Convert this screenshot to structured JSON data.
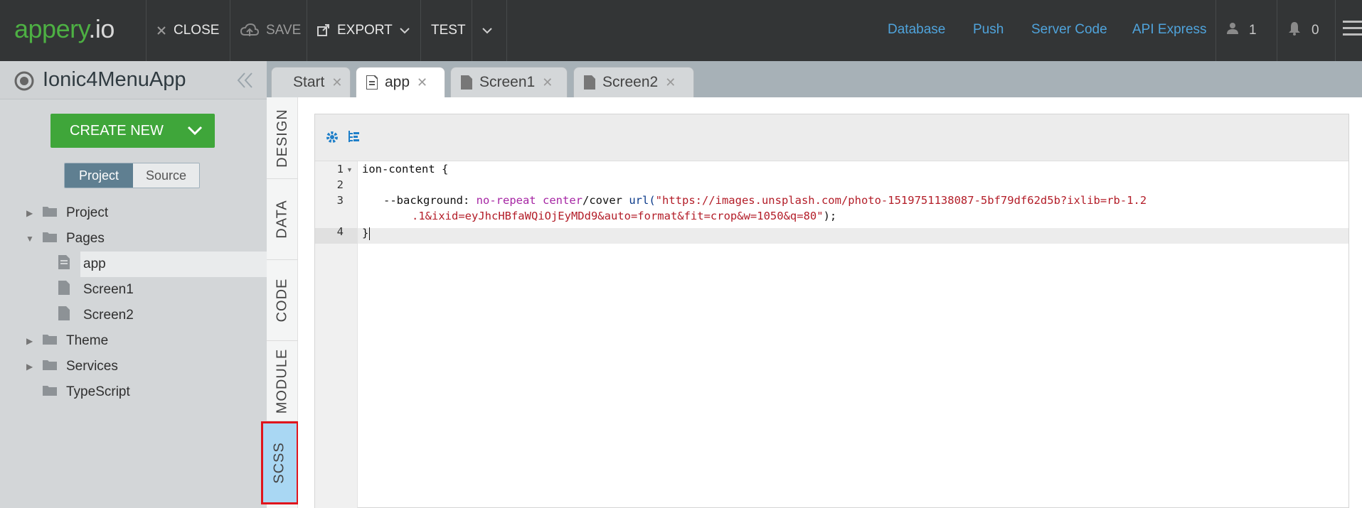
{
  "app": {
    "logo_main": "appery",
    "logo_suffix": ".io"
  },
  "toolbar": {
    "close_label": "CLOSE",
    "save_label": "SAVE",
    "export_label": "EXPORT",
    "test_label": "TEST",
    "links": [
      "Database",
      "Push",
      "Server Code",
      "API Express"
    ],
    "users_count": "1",
    "notifications_count": "0"
  },
  "project": {
    "title": "Ionic4MenuApp",
    "create_new_label": "CREATE NEW",
    "view_toggle": {
      "selected": "Project",
      "other": "Source"
    },
    "tree": [
      {
        "label": "Project",
        "type": "folder",
        "expanded": false
      },
      {
        "label": "Pages",
        "type": "folder",
        "expanded": true
      },
      {
        "label": "app",
        "type": "page",
        "selected": true
      },
      {
        "label": "Screen1",
        "type": "page"
      },
      {
        "label": "Screen2",
        "type": "page"
      },
      {
        "label": "Theme",
        "type": "folder",
        "expanded": false
      },
      {
        "label": "Services",
        "type": "folder",
        "expanded": false
      },
      {
        "label": "TypeScript",
        "type": "folder",
        "expanded": false
      }
    ]
  },
  "editor_tabs": [
    {
      "label": "Start"
    },
    {
      "label": "app",
      "active": true
    },
    {
      "label": "Screen1"
    },
    {
      "label": "Screen2"
    }
  ],
  "side_tabs": [
    {
      "label": "DESIGN"
    },
    {
      "label": "DATA"
    },
    {
      "label": "CODE"
    },
    {
      "label": "MODULE"
    },
    {
      "label": "SCSS",
      "active": true
    }
  ],
  "code": {
    "line_numbers": [
      "1",
      "2",
      "3",
      "4"
    ],
    "line1": "ion-content {",
    "line3_prop": "--background: ",
    "line3_val1": "no-repeat",
    "line3_sp": " ",
    "line3_val2": "center",
    "line3_slash": "/cover ",
    "line3_fn": "url(",
    "line3_str1": "\"https://images.unsplash.com/photo-1519751138087-5bf79df62d5b?ixlib=rb-1.2",
    "line3_str2": ".1&ixid=eyJhcHBfaWQiOjEyMDd9&auto=format&fit=crop&w=1050&q=80\"",
    "line3_end": ");",
    "line4": "}"
  },
  "colors": {
    "accent_green": "#3fa63a",
    "link_blue": "#4fa3db",
    "active_tab_highlight": "#a9d7f3",
    "annotation_red": "#e0141c"
  }
}
